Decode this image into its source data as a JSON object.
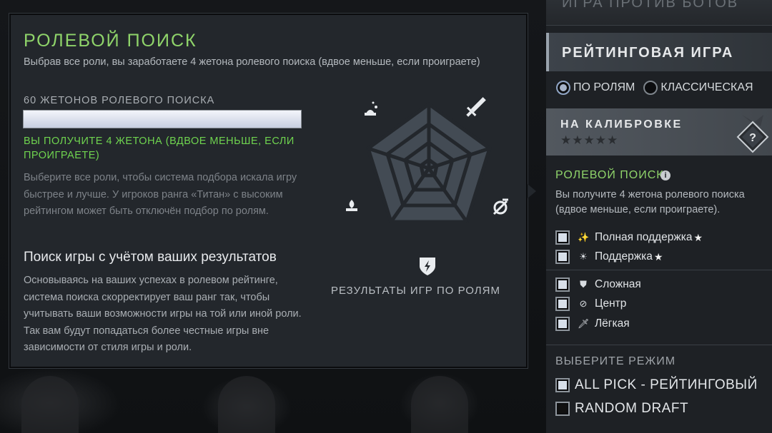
{
  "tooltip": {
    "title": "РОЛЕВОЙ ПОИСК",
    "subtitle": "Выбрав все роли, вы заработаете 4 жетона ролевого поиска (вдвое меньше, если проиграете)",
    "tokens_label": "60 ЖЕТОНОВ РОЛЕВОГО ПОИСКА",
    "tokens_progress_fraction": 1.0,
    "tokens_gain": "ВЫ ПОЛУЧИТЕ 4 ЖЕТОНА (ВДВОЕ МЕНЬШЕ, ЕСЛИ ПРОИГРАЕТЕ)",
    "description": "Выберите все роли, чтобы система подбора искала игру быстрее и лучше. У игроков ранга «Титан» с высоким рейтингом может быть отключён подбор по ролям.",
    "heading2": "Поиск игры с учётом ваших результатов",
    "description2": "Основываясь на ваших успехах в ролевом рейтинге, система поиска скорректирует ваш ранг так, чтобы учитывать ваши возможности игры на той или иной роли. Так вам будут попадаться более честные игры вне зависимости от стиля игры и роли.",
    "radar_caption": "РЕЗУЛЬТАТЫ ИГР ПО РОЛЯМ",
    "radar_icons": [
      "hard-support-icon",
      "carry-icon",
      "mid-icon",
      "offlane-icon",
      "soft-support-icon"
    ]
  },
  "sidebar": {
    "bots_label": "ИГРА ПРОТИВ БОТОВ",
    "ranked_label": "РЕЙТИНГОВАЯ ИГРА",
    "queue_types": [
      {
        "label": "ПО РОЛЯМ",
        "selected": true
      },
      {
        "label": "КЛАССИЧЕСКАЯ",
        "selected": false
      }
    ],
    "calibration_label": "НА КАЛИБРОВКЕ",
    "calibration_stars": "★★★★★",
    "role_title": "РОЛЕВОЙ ПОИСК",
    "role_desc": "Вы получите 4 жетона ролевого поиска (вдвое меньше, если проиграете).",
    "roles": [
      {
        "label": "Полная поддержка",
        "icon": "hard-support-icon",
        "glyph": "✨",
        "starred": true,
        "checked": true
      },
      {
        "label": "Поддержка",
        "icon": "soft-support-icon",
        "glyph": "☀",
        "starred": true,
        "checked": true
      },
      {
        "label": "Сложная",
        "icon": "offlane-icon",
        "glyph": "⛊",
        "starred": false,
        "checked": true
      },
      {
        "label": "Центр",
        "icon": "mid-icon",
        "glyph": "⊘",
        "starred": false,
        "checked": true
      },
      {
        "label": "Лёгкая",
        "icon": "carry-icon",
        "glyph": "🗡",
        "starred": false,
        "checked": true
      }
    ],
    "star_glyph": "★",
    "mode_title": "ВЫБЕРИТЕ РЕЖИМ",
    "modes": [
      {
        "label": "ALL PICK - РЕЙТИНГОВЫЙ",
        "checked": true
      },
      {
        "label": "RANDOM DRAFT",
        "checked": false
      }
    ]
  },
  "colors": {
    "accent_green": "#8fd46a",
    "panel_bg": "#23272c"
  }
}
